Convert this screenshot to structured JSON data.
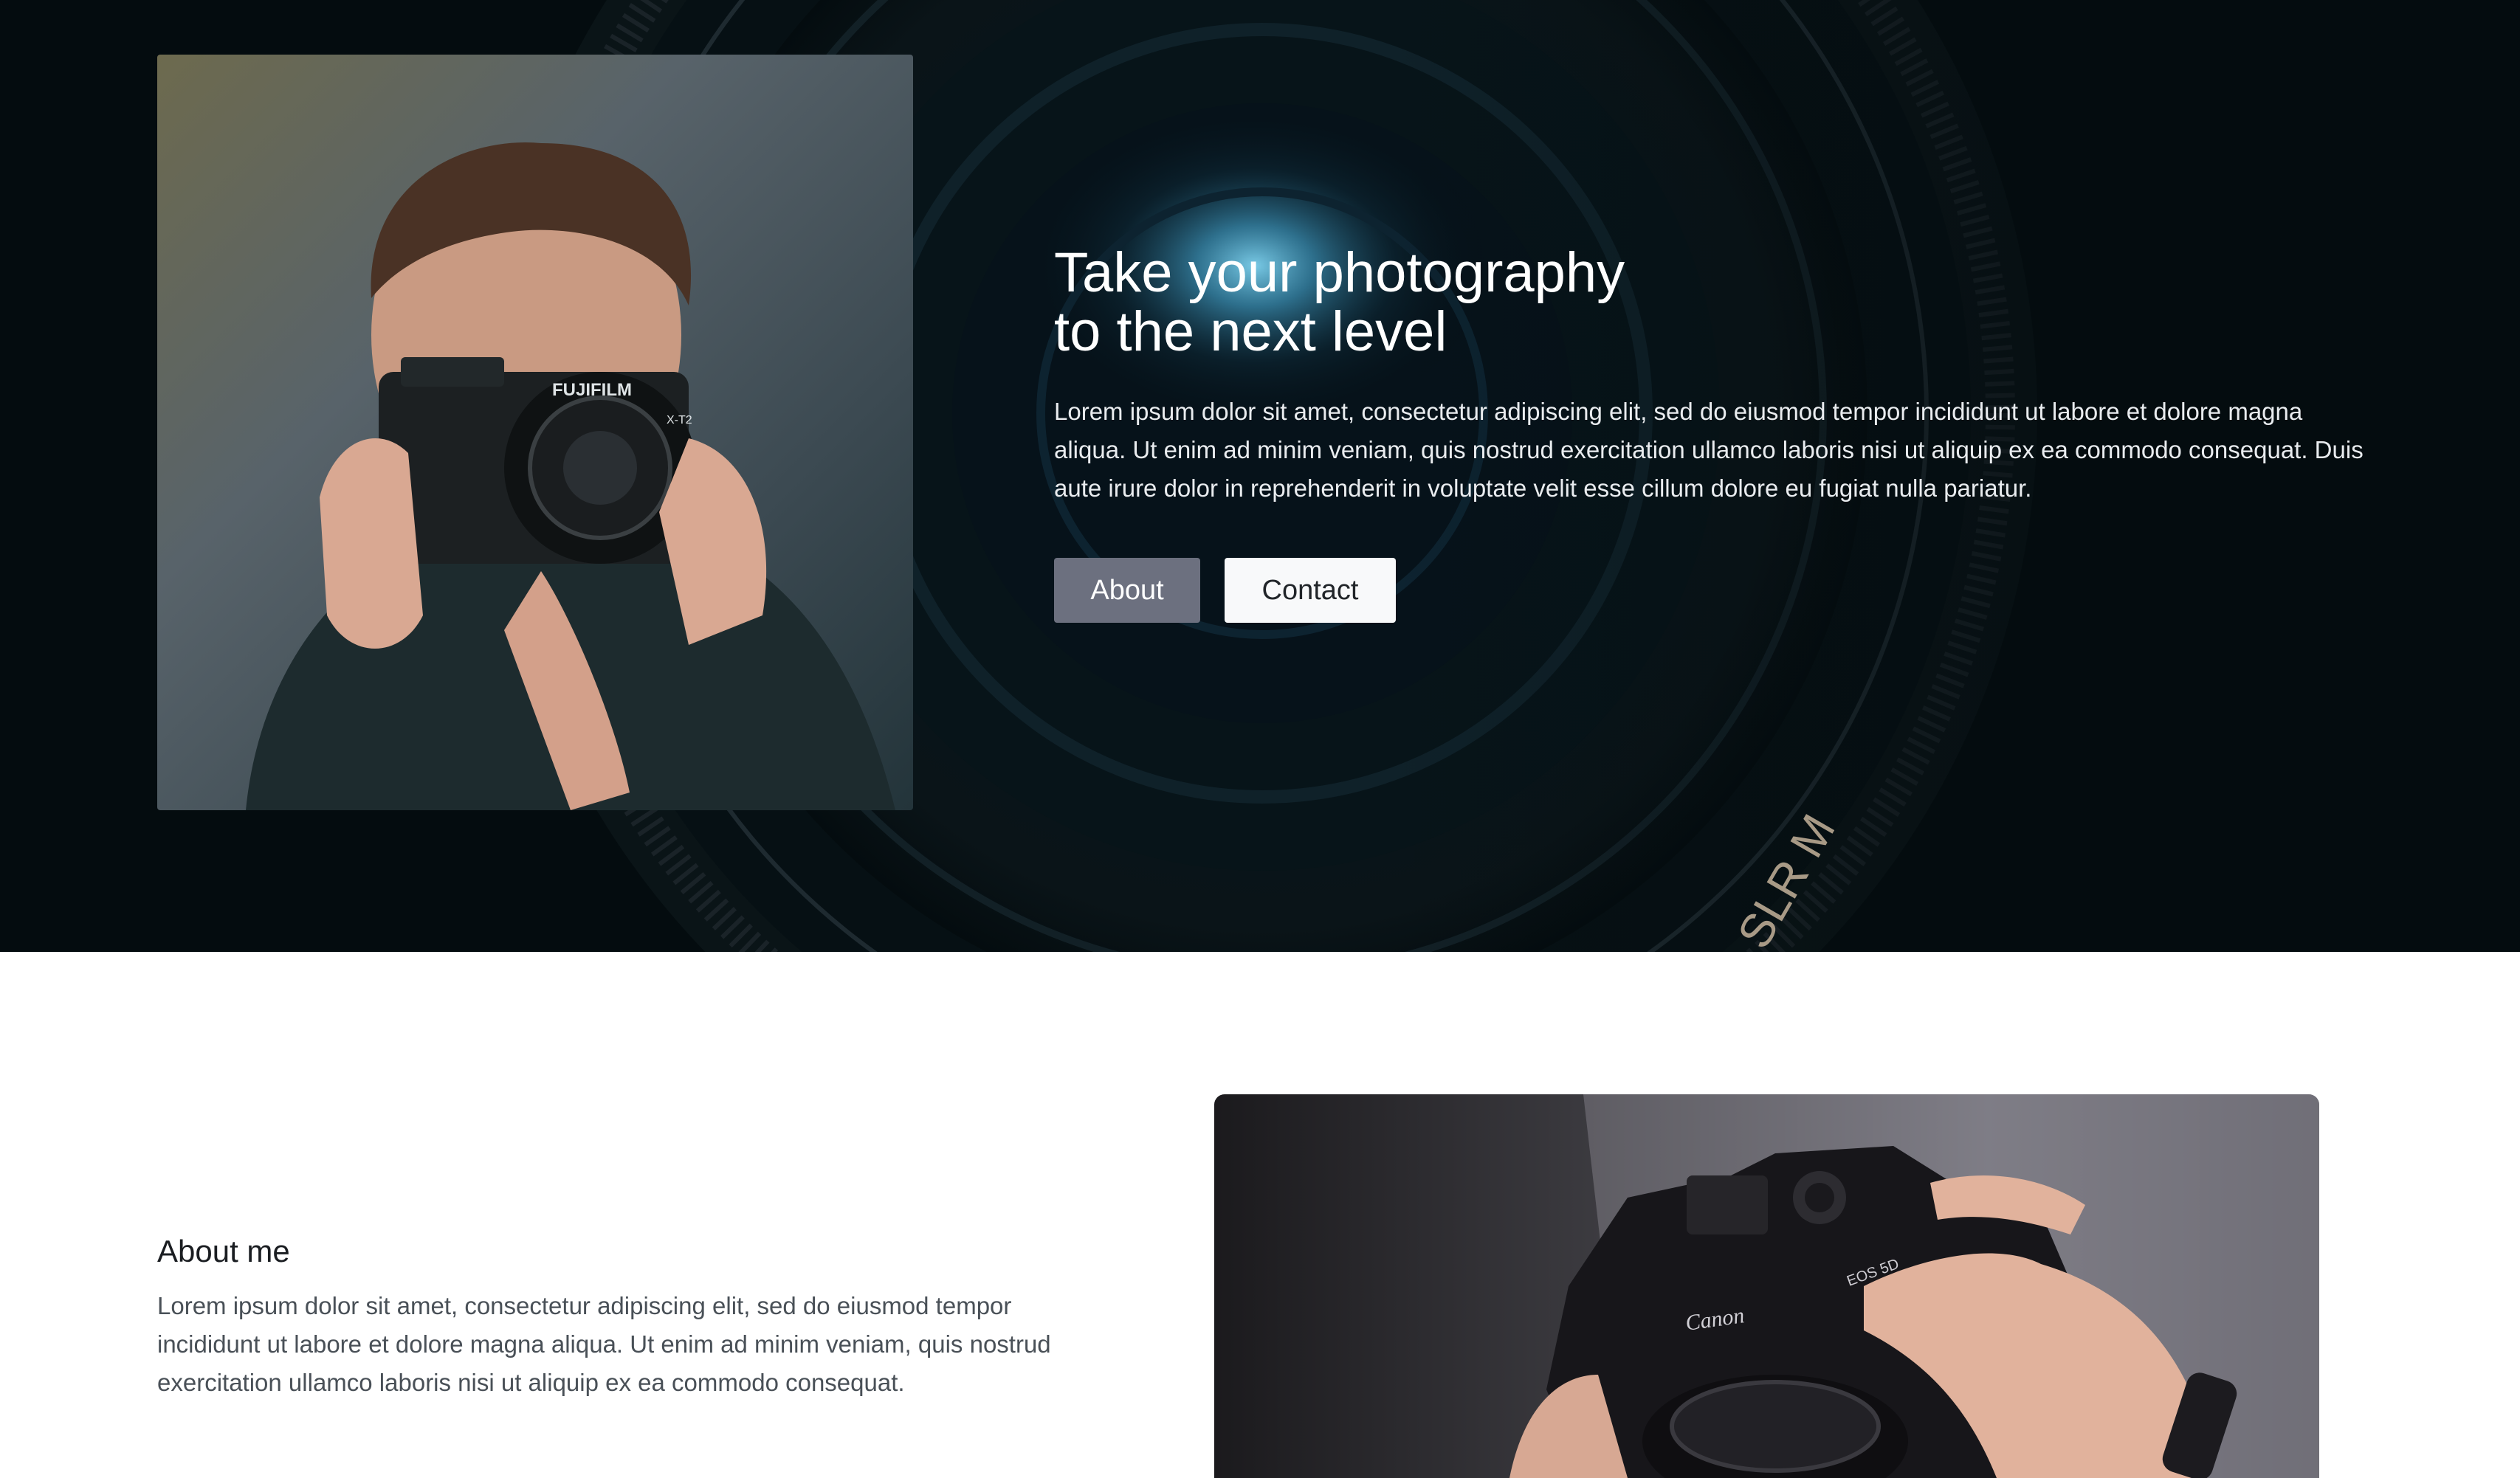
{
  "hero": {
    "title_line1": "Take your photography",
    "title_line2": "to the next level",
    "description": "Lorem ipsum dolor sit amet, consectetur adipiscing elit, sed do eiusmod tempor incididunt ut labore et dolore magna aliqua. Ut enim ad minim veniam, quis nostrud exercitation ullamco laboris nisi ut aliquip ex ea commodo consequat. Duis aute irure dolor in reprehenderit in voluptate velit esse cillum dolore eu fugiat nulla pariatur.",
    "about_button": "About",
    "contact_button": "Contact",
    "background_lens_text": "SLR M",
    "camera_brand_text": "FUJIFILM",
    "camera_model_text": "X-T2"
  },
  "about": {
    "heading": "About me",
    "text": "Lorem ipsum dolor sit amet, consectetur adipiscing elit, sed do eiusmod tempor incididunt ut labore et dolore magna aliqua. Ut enim ad minim veniam, quis nostrud exercitation ullamco laboris nisi ut aliquip ex ea commodo consequat.",
    "camera_brand_text": "Canon",
    "camera_model_text": "EOS 5D"
  },
  "colors": {
    "hero_background": "#040c0f",
    "about_button_bg": "#6c707f",
    "contact_button_bg": "#f8f9fa",
    "body_text": "#495057",
    "heading_text": "#1a1d21"
  },
  "icons": {
    "hero_background": "camera-lens-image",
    "hero_photo": "photographer-with-camera-image",
    "about_photo": "hands-holding-dslr-image"
  }
}
